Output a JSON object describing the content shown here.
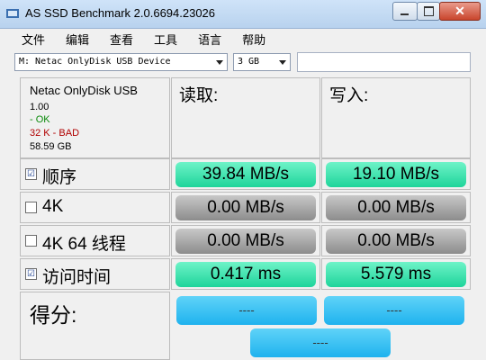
{
  "window": {
    "title": "AS SSD Benchmark 2.0.6694.23026",
    "minimize_glyph": "",
    "close_glyph": "✕"
  },
  "menu": [
    "文件",
    "编辑",
    "查看",
    "工具",
    "语言",
    "帮助"
  ],
  "toolbar": {
    "drive": "M: Netac OnlyDisk USB Device",
    "size": "3 GB",
    "field_value": ""
  },
  "device": {
    "name": "Netac OnlyDisk USB",
    "version": "1.00",
    "status_ok": " - OK",
    "alignment": "32 K - BAD",
    "capacity": "58.59 GB"
  },
  "columns": {
    "read": "读取:",
    "write": "写入:"
  },
  "tests": [
    {
      "label": "顺序",
      "checked": true,
      "read": "39.84 MB/s",
      "write": "19.10 MB/s",
      "read_state": "green",
      "write_state": "green"
    },
    {
      "label": "4K",
      "checked": false,
      "read": "0.00 MB/s",
      "write": "0.00 MB/s",
      "read_state": "gray",
      "write_state": "gray"
    },
    {
      "label": "4K 64 线程",
      "checked": false,
      "read": "0.00 MB/s",
      "write": "0.00 MB/s",
      "read_state": "gray",
      "write_state": "gray"
    },
    {
      "label": "访问时间",
      "checked": true,
      "read": "0.417 ms",
      "write": "5.579 ms",
      "read_state": "green",
      "write_state": "green"
    }
  ],
  "score": {
    "label": "得分:",
    "read": "----",
    "write": "----",
    "total": "----"
  },
  "colors": {
    "green": "#2fe0a6",
    "gray": "#a8a8a8",
    "score_blue": "#35c0f4"
  },
  "checkbox_glyph": "☑"
}
